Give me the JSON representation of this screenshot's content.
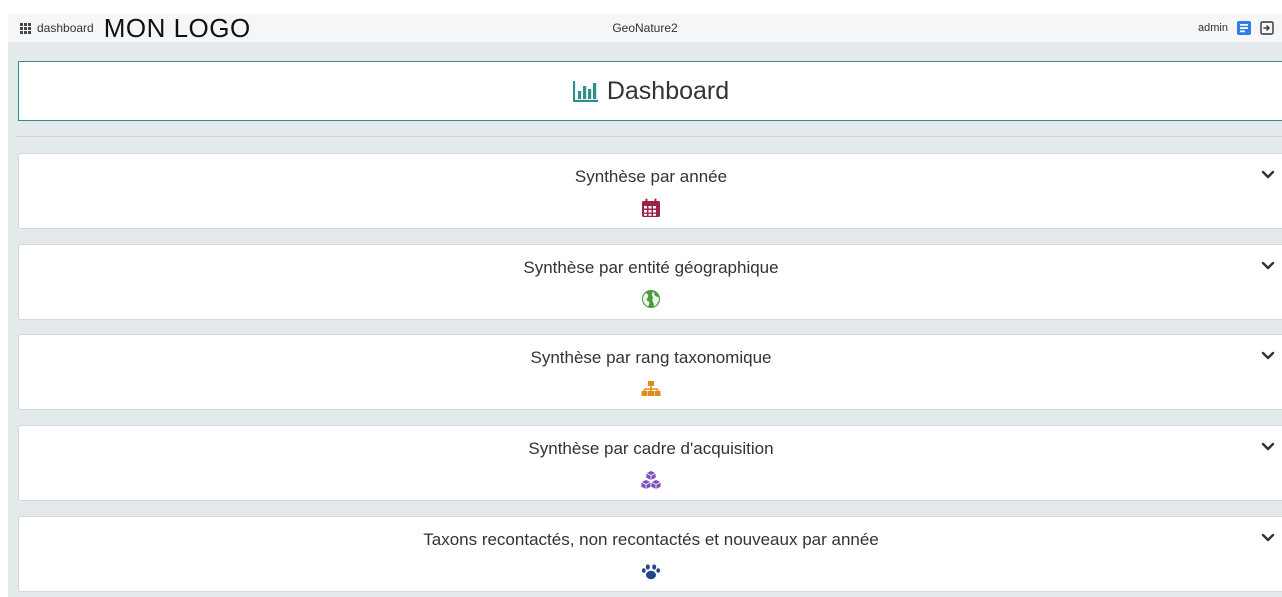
{
  "navbar": {
    "module_name": "dashboard",
    "logo_text": "MON LOGO",
    "app_title": "GeoNature2",
    "username": "admin"
  },
  "header": {
    "title": "Dashboard"
  },
  "panels": [
    {
      "title": "Synthèse par année",
      "icon": "calendar-icon",
      "color": "#9c2344"
    },
    {
      "title": "Synthèse par entité géographique",
      "icon": "globe-icon",
      "color": "#4a9a3a"
    },
    {
      "title": "Synthèse par rang taxonomique",
      "icon": "sitemap-icon",
      "color": "#e08a1e"
    },
    {
      "title": "Synthèse par cadre d'acquisition",
      "icon": "cubes-icon",
      "color": "#7c4fb8"
    },
    {
      "title": "Taxons recontactés, non recontactés et nouveaux par année",
      "icon": "paw-icon",
      "color": "#23458f"
    }
  ],
  "colors": {
    "accent": "#2f8f8a",
    "background": "#e4e9ec",
    "navbar": "#f4f6f7",
    "user_icon": "#2f7ee8"
  }
}
